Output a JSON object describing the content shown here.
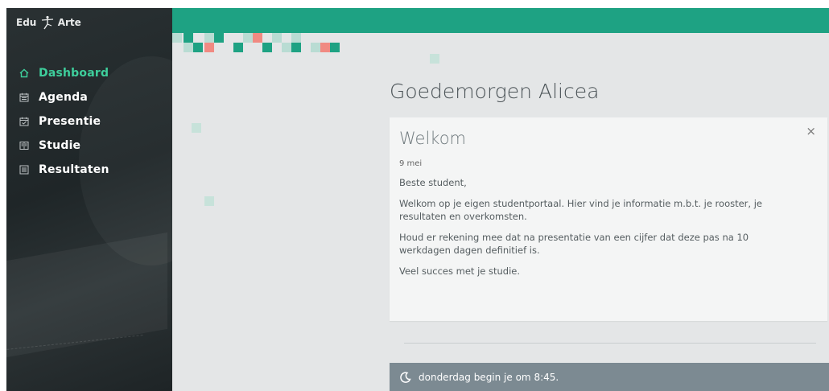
{
  "app": {
    "logo_left": "Edu",
    "logo_right": "Arte"
  },
  "sidebar": {
    "items": [
      {
        "label": "Dashboard",
        "icon": "home-icon",
        "active": true
      },
      {
        "label": "Agenda",
        "icon": "calendar-icon",
        "active": false
      },
      {
        "label": "Presentie",
        "icon": "calendar-check-icon",
        "active": false
      },
      {
        "label": "Studie",
        "icon": "book-icon",
        "active": false
      },
      {
        "label": "Resultaten",
        "icon": "list-icon",
        "active": false
      }
    ]
  },
  "main": {
    "greeting": "Goedemorgen Alicea",
    "card": {
      "title": "Welkom",
      "date": "9 mei",
      "close_label": "×",
      "paragraphs": [
        "Beste student,",
        "Welkom op je eigen studentportaal. Hier vind je informatie m.b.t. je rooster, je resultaten en overkomsten.",
        "Houd er rekening mee dat na presentatie van een cijfer dat deze pas na 10 werkdagen dagen definitief is.",
        "Veel succes met je studie."
      ]
    },
    "notice": {
      "icon": "moon-icon",
      "text": "donderdag begin je om 8:45."
    }
  },
  "colors": {
    "accent": "#1ea283",
    "active_nav": "#3ecf9c",
    "sidebar_bg": "#252c2e",
    "notice_bg": "#7c8a92",
    "pixel_teal": "#1ea283",
    "pixel_light": "#b9dcd3",
    "pixel_red": "#f08a82"
  }
}
